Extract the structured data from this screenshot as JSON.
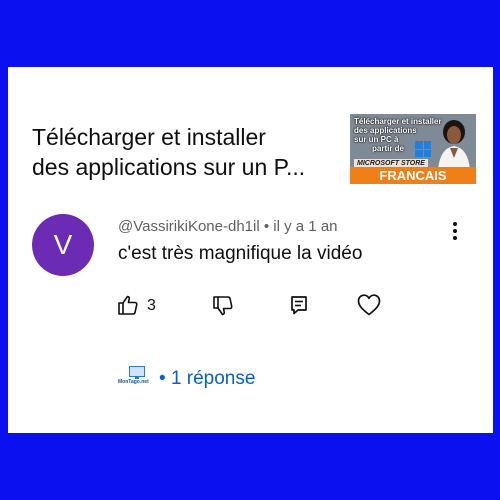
{
  "video": {
    "title_line1": "Télécharger et installer",
    "title_line2": "des applications sur un P...",
    "thumbnail": {
      "line1": "Télécharger et installer",
      "line2": "des applications",
      "line3": "sur un PC à",
      "line4": "partir de",
      "store": "MICROSOFT STORE",
      "banner": "FRANCAIS",
      "banner_color": "#f07f18"
    }
  },
  "comment": {
    "avatar_letter": "V",
    "avatar_color": "#6b2bb5",
    "author": "@VassirikiKone-dh1il",
    "separator": "•",
    "time": "il y a 1 an",
    "text": "c'est très magnifique la vidéo",
    "likes": "3",
    "icons": [
      "thumbs-up-icon",
      "thumbs-down-icon",
      "reply-icon",
      "heart-icon",
      "more-vertical-icon"
    ]
  },
  "replies": {
    "creator_logo_text": "MonTago.net",
    "bullet": "•",
    "label": "1 réponse",
    "link_color": "#065fd4"
  },
  "page": {
    "background": "#0a10f0"
  }
}
